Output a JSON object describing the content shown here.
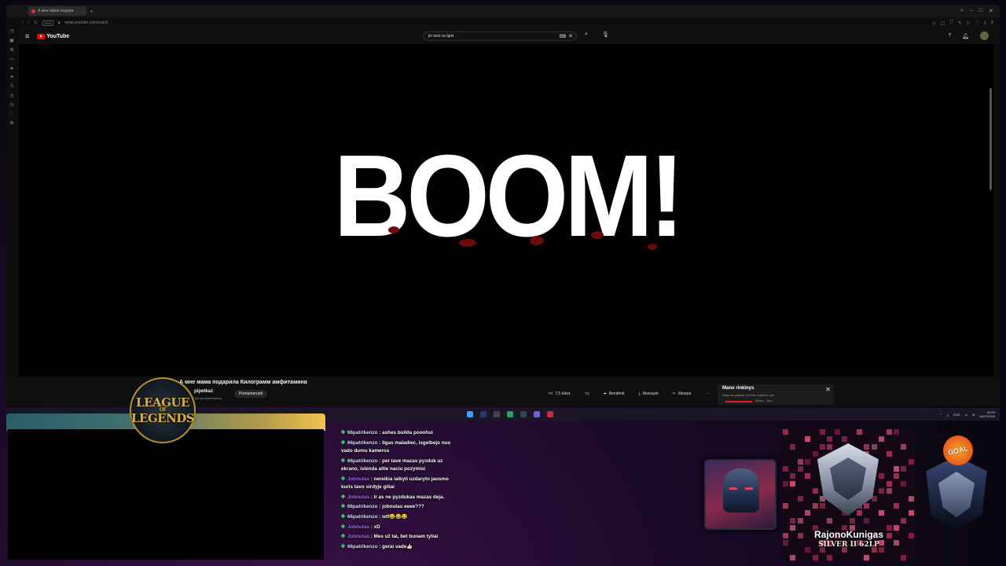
{
  "browser": {
    "tab_title": "А мне мама подари",
    "url": "www.youtube.com/watch",
    "vpn_label": "VPN"
  },
  "youtube": {
    "logo_text": "YouTube",
    "search_value": "jin woo vs igris",
    "video_overlay_text": "BOOM!",
    "video_title": "А мне мама подарила Килограмм амфитамина",
    "channel_name": "pipetkaz",
    "channel_subs": "189 prenumeratorių",
    "subscribe_label": "Prenumeruoti",
    "like_count": "7,5 tūkst.",
    "share_label": "Bendrinti",
    "download_label": "Atsisiųsti",
    "clip_label": "Iškarpa",
    "more_label": "···",
    "mix_title": "Mano rinkinys",
    "mix_subtitle": "Mixes are playlists YouTube makes for you",
    "mix_meta": "Skrenu · Tozo"
  },
  "taskbar": {
    "lang": "ENG",
    "time": "00:29",
    "date": "16/07/2025"
  },
  "overlay": {
    "lol_line1": "LEAGUE",
    "lol_line2": "OF",
    "lol_line3": "LEGENDS",
    "goal_text": "GOAL",
    "rank_name": "RajonoKunigas",
    "rank_tier": "SILVER II 62LP"
  },
  "chat": [
    {
      "user": "66patrikenzo",
      "text": "ashes builda pooohui",
      "cls": "u1"
    },
    {
      "user": "66patrikenzo",
      "text": "Ilgas maladiec, isgelbejo nuo vado dumu kameros",
      "cls": "u1"
    },
    {
      "user": "66patrikenzo",
      "text": "per tave mazas pyzduk uz ekrano, islenda altie naciu pozymisi",
      "cls": "u1"
    },
    {
      "user": "Jobnutas",
      "text": "nereikia laikyti uzdaryto jausmo kuris tavo sirdyje giliai",
      "cls": "u2"
    },
    {
      "user": "Jobnutas",
      "text": "Ir as ne pyzdukas mazas deja.",
      "cls": "u2"
    },
    {
      "user": "66patrikenzo",
      "text": "jobnutas eeee???",
      "cls": "u1"
    },
    {
      "user": "66patrikenzo",
      "text": "wtf😂😂😂",
      "cls": "u1"
    },
    {
      "user": "Jobnutas",
      "text": "xD",
      "cls": "u2"
    },
    {
      "user": "Jobnutas",
      "text": "Mes už tai, bet bunam tyliai",
      "cls": "u2"
    },
    {
      "user": "66patrikenzo",
      "text": "gerai vade👍🏻",
      "cls": "u1"
    }
  ]
}
